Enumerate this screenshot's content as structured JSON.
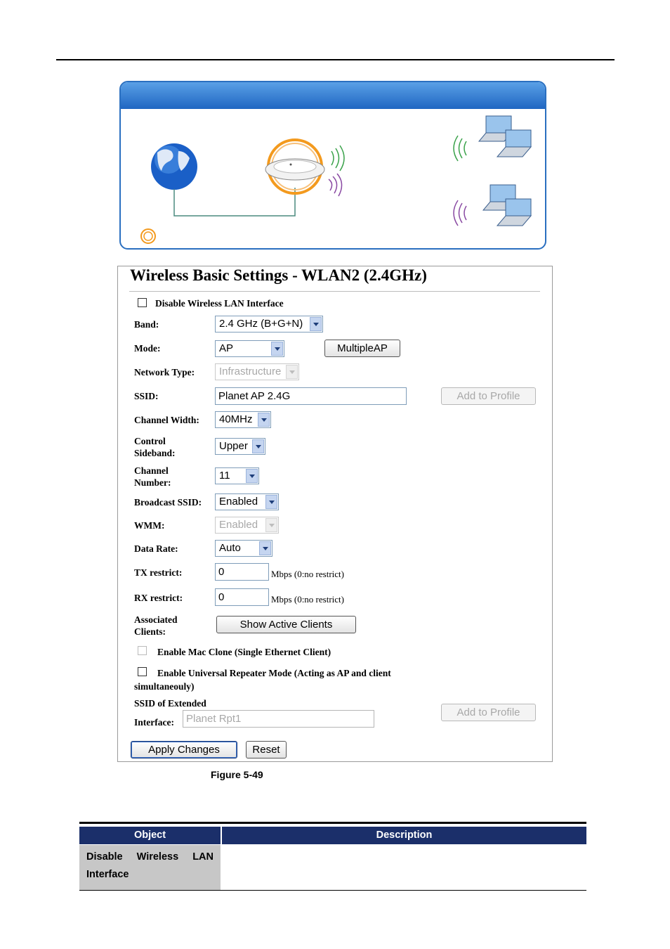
{
  "panel": {
    "title": "Wireless Basic Settings - WLAN2 (2.4GHz)",
    "disable_wlan_label": "Disable Wireless LAN Interface",
    "band": {
      "label": "Band:",
      "value": "2.4 GHz (B+G+N)"
    },
    "mode": {
      "label": "Mode:",
      "value": "AP",
      "multiple_ap": "MultipleAP"
    },
    "network_type": {
      "label": "Network Type:",
      "value": "Infrastructure"
    },
    "ssid": {
      "label": "SSID:",
      "value": "Planet AP 2.4G",
      "add_profile": "Add to Profile"
    },
    "channel_width": {
      "label": "Channel Width:",
      "value": "40MHz"
    },
    "control_sideband": {
      "label_1": "Control",
      "label_2": "Sideband:",
      "value": "Upper"
    },
    "channel_number": {
      "label_1": "Channel",
      "label_2": "Number:",
      "value": "11"
    },
    "broadcast_ssid": {
      "label": "Broadcast SSID:",
      "value": "Enabled"
    },
    "wmm": {
      "label": "WMM:",
      "value": "Enabled"
    },
    "data_rate": {
      "label": "Data Rate:",
      "value": "Auto"
    },
    "tx_restrict": {
      "label": "TX restrict:",
      "value": "0",
      "unit": "Mbps (0:no restrict)"
    },
    "rx_restrict": {
      "label": "RX restrict:",
      "value": "0",
      "unit": "Mbps (0:no restrict)"
    },
    "associated_clients": {
      "label_1": "Associated",
      "label_2": "Clients:",
      "button": "Show Active Clients"
    },
    "mac_clone_label": "Enable Mac Clone (Single Ethernet Client)",
    "repeater_label_1": "Enable Universal Repeater Mode (Acting as AP and client",
    "repeater_label_2": "simultaneouly)",
    "extended_ssid": {
      "label_1": "SSID of Extended",
      "label_2": "Interface:",
      "value": "Planet Rpt1",
      "add_profile": "Add to Profile"
    },
    "apply_button": "Apply Changes",
    "reset_button": "Reset"
  },
  "figure_caption": "Figure 5-49",
  "table": {
    "headers": [
      "Object",
      "Description"
    ],
    "rows": [
      {
        "object_1": "Disable Wireless LAN",
        "object_2": "Interface",
        "description": ""
      }
    ]
  },
  "colors": {
    "banner_blue": "#1f66c2",
    "table_header": "#1b2f6a",
    "table_object_bg": "#c7c7c7",
    "ap_ring": "#f39a1e"
  },
  "icons": [
    "globe-icon",
    "access-point-icon",
    "laptop-icon",
    "wifi-signal-icon",
    "ring-icon"
  ]
}
